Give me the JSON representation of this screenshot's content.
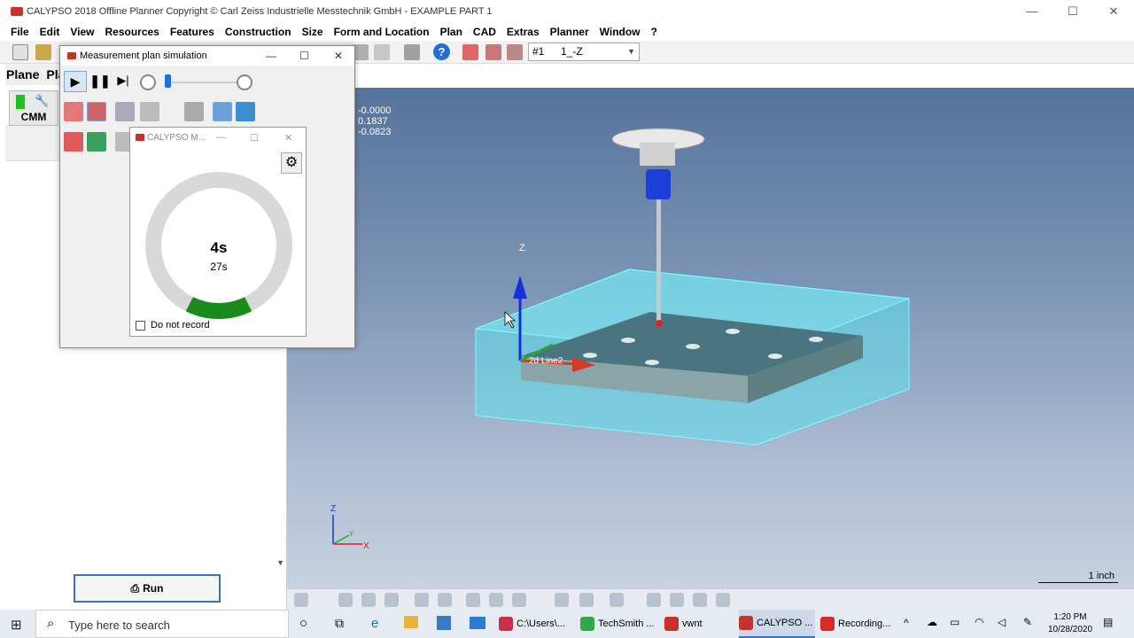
{
  "app": {
    "title": "CALYPSO 2018 Offline Planner Copyright © Carl Zeiss Industrielle Messtechnik GmbH - EXAMPLE PART  1",
    "min": "—",
    "max": "☐",
    "close": "✕"
  },
  "menu": [
    "File",
    "Edit",
    "View",
    "Resources",
    "Features",
    "Construction",
    "Size",
    "Form and Location",
    "Plan",
    "CAD",
    "Extras",
    "Planner",
    "Window",
    "?"
  ],
  "toolbar": {
    "combo_num": "#1",
    "combo_val": "1_-Z",
    "help": "?"
  },
  "left_panel": {
    "tab1": "Plane",
    "tab2": "Pla",
    "cmm_label": "CMM",
    "run_label": "Run"
  },
  "sim_window": {
    "title": "Measurement plan simulation",
    "min": "—",
    "max": "☐",
    "close": "✕",
    "play": "▶",
    "pause": "❚❚",
    "next": "▶|"
  },
  "timer_window": {
    "title": "CALYPSO M...",
    "main_time": "4s",
    "total_time": "27s",
    "progress": 0.148,
    "checkbox_label": "Do not record",
    "min": "—",
    "max": "☐",
    "close": "✕"
  },
  "viewport": {
    "coords": [
      "-0.0000",
      "0.1837",
      "-0.0823"
    ],
    "axis_z": "Z",
    "label_2d": "2d Line2",
    "triad_z": "Z",
    "triad_x": "X",
    "triad_y": "Y",
    "scale_label": "1 inch"
  },
  "taskbar": {
    "search_placeholder": "Type here to search",
    "tasks": [
      "C:\\Users\\...",
      "TechSmith ...",
      "vwnt",
      "CALYPSO ...",
      "Recording..."
    ],
    "time": "1:20 PM",
    "date": "10/28/2020"
  }
}
